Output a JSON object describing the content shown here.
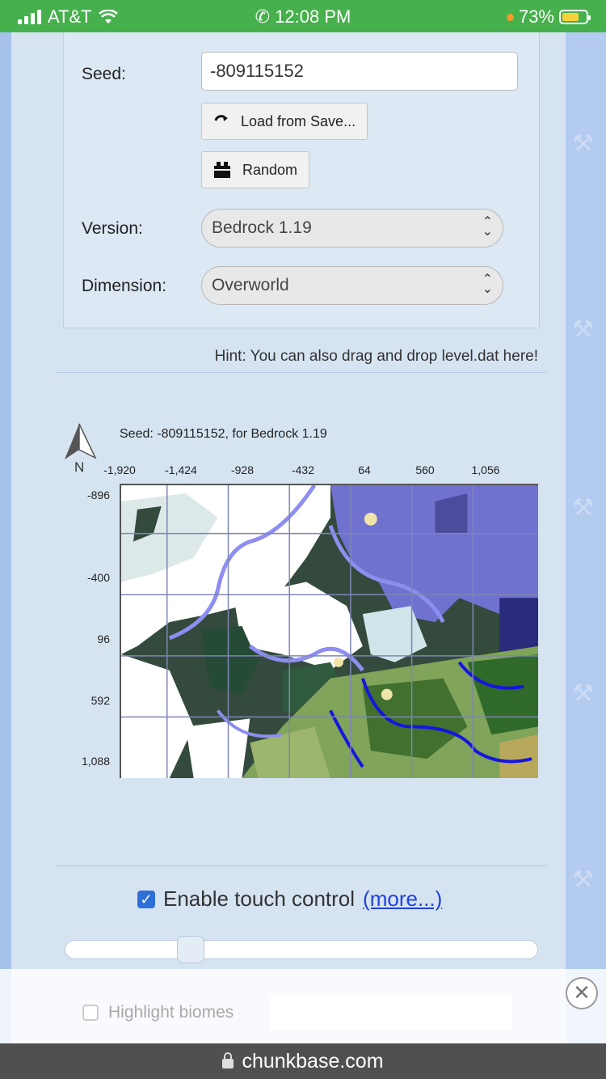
{
  "status_bar": {
    "carrier": "AT&T",
    "time": "12:08 PM",
    "battery": "73%",
    "battery_level": 0.73
  },
  "form": {
    "seed_label": "Seed:",
    "seed_value": "-809115152",
    "load_button": "Load from Save...",
    "random_button": "Random",
    "version_label": "Version:",
    "version_value": "Bedrock 1.19",
    "dimension_label": "Dimension:",
    "dimension_value": "Overworld"
  },
  "hint": "Hint: You can also drag and drop level.dat here!",
  "map": {
    "title": "Seed: -809115152, for Bedrock 1.19",
    "north_label": "N",
    "x_ticks": [
      "-1,920",
      "-1,424",
      "-928",
      "-432",
      "64",
      "560",
      "1,056"
    ],
    "y_ticks": [
      "-896",
      "-400",
      "96",
      "592",
      "1,088"
    ]
  },
  "touch": {
    "label": "Enable touch control",
    "more_link": "(more...)",
    "checked": true,
    "slider_fraction": 0.25
  },
  "overlay": {
    "highlight_label": "Highlight biomes",
    "close_symbol": "✕"
  },
  "url_bar": {
    "domain": "chunkbase.com"
  }
}
